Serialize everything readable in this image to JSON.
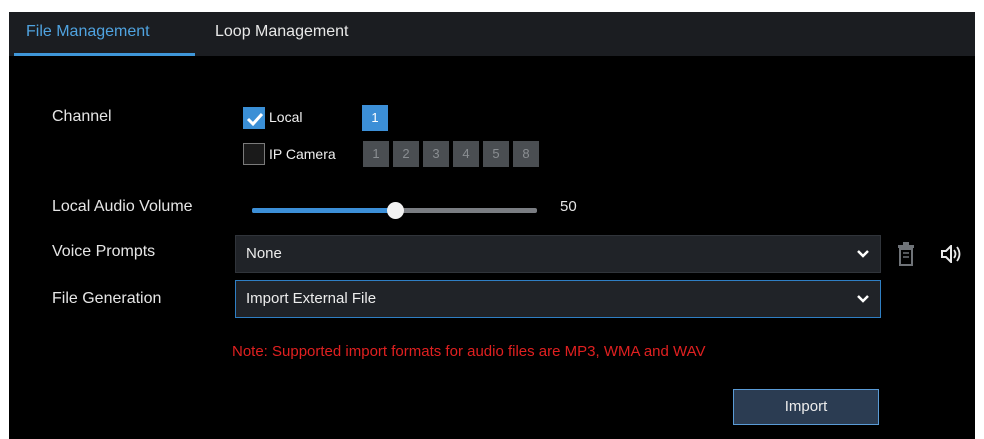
{
  "tabs": [
    {
      "label": "File Management",
      "active": true
    },
    {
      "label": "Loop Management",
      "active": false
    }
  ],
  "channel": {
    "label": "Channel",
    "local": {
      "label": "Local",
      "checked": true,
      "buttons": [
        "1"
      ]
    },
    "ip_camera": {
      "label": "IP Camera",
      "checked": false,
      "buttons": [
        "1",
        "2",
        "3",
        "4",
        "5",
        "8"
      ]
    }
  },
  "audio_volume": {
    "label": "Local Audio Volume",
    "value": "50",
    "fraction": 0.5
  },
  "voice_prompts": {
    "label": "Voice Prompts",
    "value": "None",
    "icons": [
      "trash-icon",
      "speaker-icon"
    ]
  },
  "file_generation": {
    "label": "File Generation",
    "value": "Import External File"
  },
  "note": "Note: Supported import formats for audio files are MP3, WMA and WAV",
  "import_button": "Import",
  "colors": {
    "accent": "#3c8fd7",
    "note_red": "#e02020",
    "background": "#000000",
    "tabbar": "#1b1d21"
  }
}
